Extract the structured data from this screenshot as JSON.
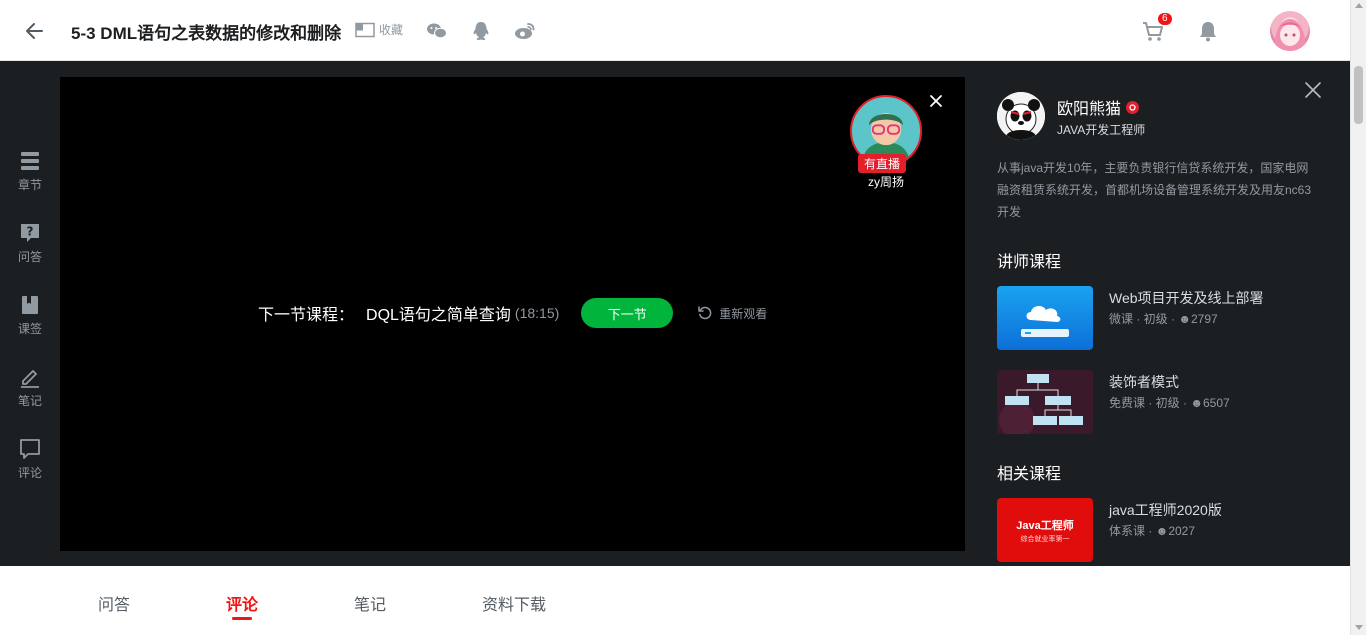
{
  "header": {
    "title": "5-3 DML语句之表数据的修改和删除",
    "favorite_label": "收藏",
    "cart_count": "6"
  },
  "sidebar": {
    "items": [
      {
        "label": "章节",
        "icon": "chapter-icon"
      },
      {
        "label": "问答",
        "icon": "question-icon"
      },
      {
        "label": "课签",
        "icon": "bookmark-icon"
      },
      {
        "label": "笔记",
        "icon": "note-icon"
      },
      {
        "label": "评论",
        "icon": "comment-icon"
      }
    ]
  },
  "player": {
    "next_prefix": "下一节课程：",
    "next_lesson": "DQL语句之简单查询",
    "next_duration": "(18:15)",
    "next_button": "下一节",
    "replay_label": "重新观看",
    "live_teacher": {
      "live_badge": "有直播",
      "name": "zy周扬"
    }
  },
  "teacher": {
    "name": "欧阳熊猫",
    "title": "JAVA开发工程师",
    "description": "从事java开发10年，主要负责银行信贷系统开发，国家电网融资租赁系统开发，首都机场设备管理系统开发及用友nc63开发"
  },
  "teacher_courses": {
    "heading": "讲师课程",
    "items": [
      {
        "name": "Web项目开发及线上部署",
        "meta": "微课 · 初级 · ",
        "students": "2797"
      },
      {
        "name": "装饰者模式",
        "meta": "免费课 · 初级 · ",
        "students": "6507"
      }
    ]
  },
  "related_courses": {
    "heading": "相关课程",
    "items": [
      {
        "name": "java工程师2020版",
        "meta": "体系课 · ",
        "students": "2027",
        "thumb_text_1": "Java工程师",
        "thumb_text_2": "综合就业率第一"
      }
    ]
  },
  "tabs": [
    {
      "label": "问答",
      "active": false
    },
    {
      "label": "评论",
      "active": true
    },
    {
      "label": "笔记",
      "active": false
    },
    {
      "label": "资料下载",
      "active": false
    }
  ],
  "colors": {
    "accent": "#f01414",
    "green": "#00b43c",
    "dark_bg": "#1c1f21"
  }
}
